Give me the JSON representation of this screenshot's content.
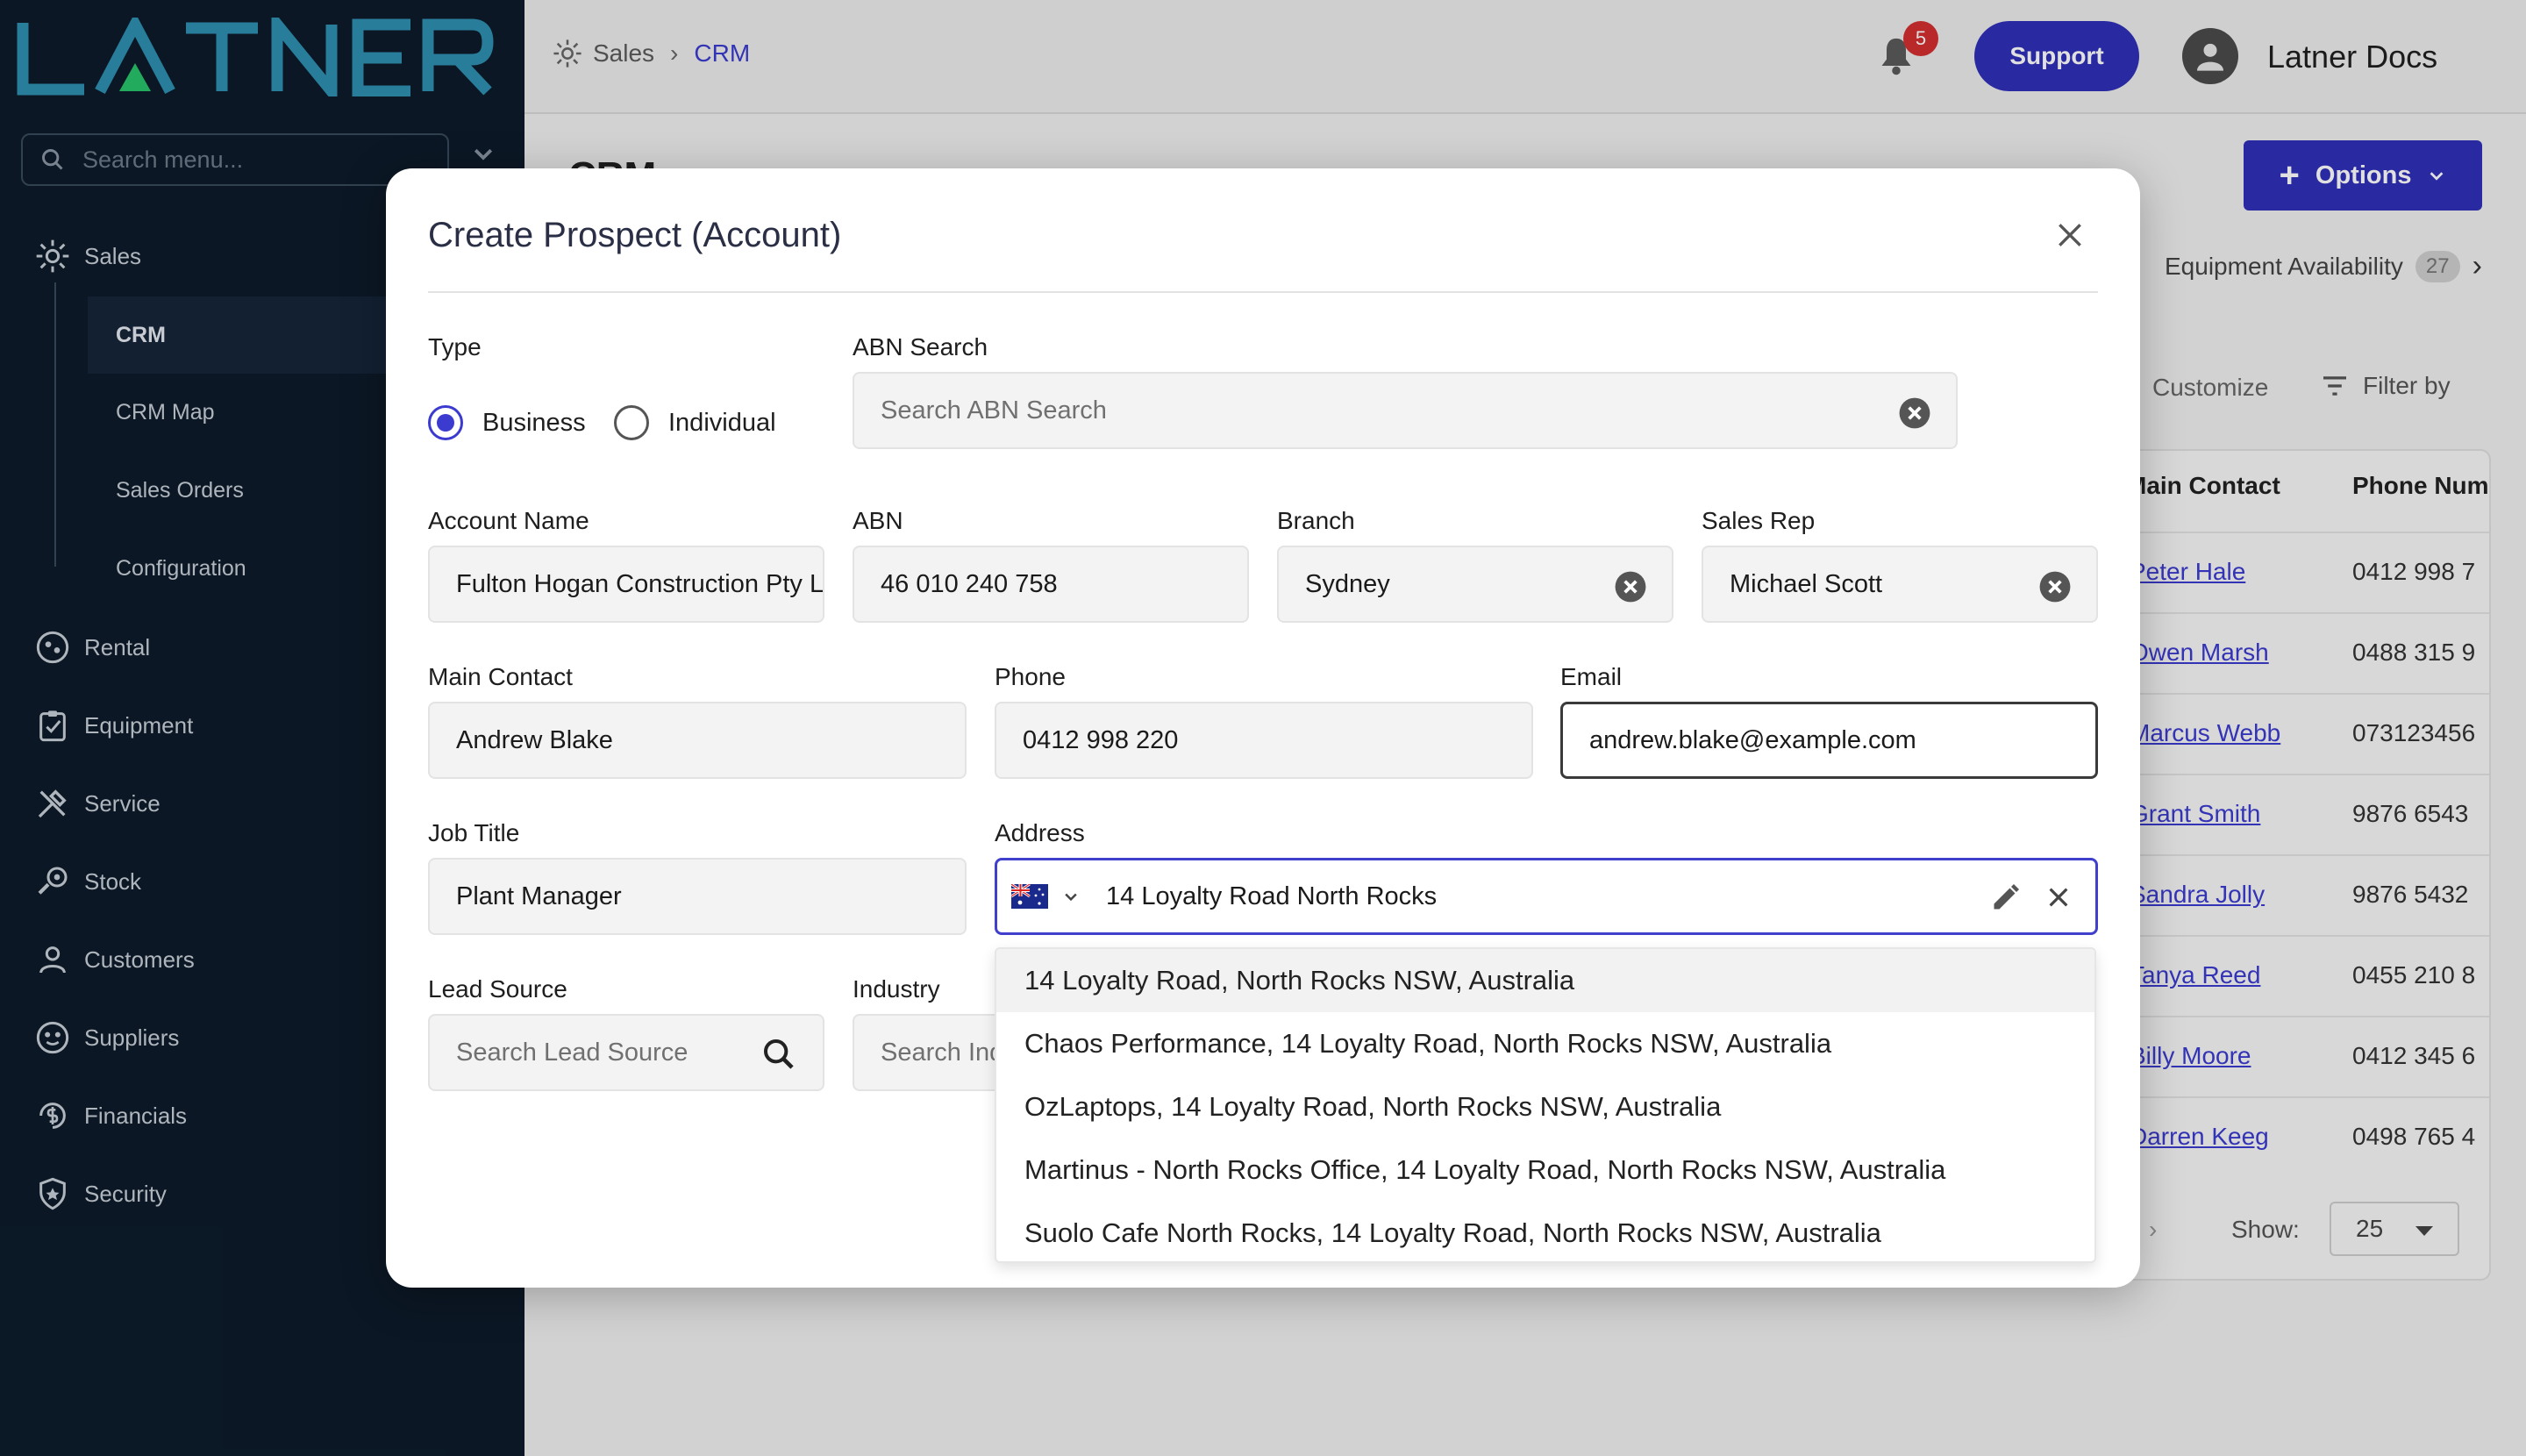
{
  "app": {
    "logo_text": "LATNER",
    "user_name": "Latner Docs",
    "support_label": "Support",
    "notification_count": "5"
  },
  "sidebar": {
    "search_placeholder": "Search menu...",
    "items": [
      {
        "label": "Sales",
        "icon": "sales-icon"
      },
      {
        "label": "Rental",
        "icon": "rental-icon"
      },
      {
        "label": "Equipment",
        "icon": "equipment-icon"
      },
      {
        "label": "Service",
        "icon": "service-icon"
      },
      {
        "label": "Stock",
        "icon": "stock-icon"
      },
      {
        "label": "Customers",
        "icon": "customers-icon"
      },
      {
        "label": "Suppliers",
        "icon": "suppliers-icon"
      },
      {
        "label": "Financials",
        "icon": "financials-icon"
      },
      {
        "label": "Security",
        "icon": "shield-icon"
      }
    ],
    "sales_sub": [
      {
        "label": "CRM",
        "active": true
      },
      {
        "label": "CRM Map"
      },
      {
        "label": "Sales Orders"
      },
      {
        "label": "Configuration"
      }
    ]
  },
  "breadcrumb": {
    "section": "Sales",
    "current": "CRM"
  },
  "page": {
    "title": "CRM",
    "options_label": "Options",
    "tab_equipment": "Equipment Availability",
    "tab_equipment_count": "27",
    "customize_label": "Customize",
    "filter_label": "Filter by",
    "show_label": "Show:",
    "show_value": "25"
  },
  "table": {
    "headers": [
      "Main Contact",
      "Phone Num"
    ],
    "rows": [
      [
        "Peter Hale",
        "0412 998 7"
      ],
      [
        "Owen Marsh",
        "0488 315 9"
      ],
      [
        "Marcus Webb",
        "073123456"
      ],
      [
        "Grant Smith",
        "9876 6543"
      ],
      [
        "Sandra Jolly",
        "9876 5432"
      ],
      [
        "Tanya Reed",
        "0455 210 8"
      ],
      [
        "Billy Moore",
        "0412 345 6"
      ],
      [
        "Darren Keeg",
        "0498 765 4"
      ]
    ]
  },
  "modal": {
    "title": "Create Prospect (Account)",
    "type_label": "Type",
    "type_options": [
      "Business",
      "Individual"
    ],
    "type_selected": "Business",
    "abn_search_label": "ABN Search",
    "abn_search_placeholder": "Search ABN Search",
    "account_name_label": "Account Name",
    "account_name_value": "Fulton Hogan Construction Pty Ltd",
    "abn_label": "ABN",
    "abn_value": "46 010 240 758",
    "branch_label": "Branch",
    "branch_value": "Sydney",
    "sales_rep_label": "Sales Rep",
    "sales_rep_value": "Michael Scott",
    "main_contact_label": "Main Contact",
    "main_contact_value": "Andrew Blake",
    "phone_label": "Phone",
    "phone_value": "0412 998 220",
    "email_label": "Email",
    "email_value": "andrew.blake@example.com",
    "job_title_label": "Job Title",
    "job_title_value": "Plant Manager",
    "address_label": "Address",
    "address_value": "14 Loyalty Road North Rocks",
    "lead_source_label": "Lead Source",
    "lead_source_placeholder": "Search Lead Source",
    "industry_label": "Industry",
    "industry_placeholder": "Search Industry",
    "address_suggestions": [
      "14 Loyalty Road, North Rocks NSW, Australia",
      "Chaos Performance, 14 Loyalty Road, North Rocks NSW, Australia",
      "OzLaptops, 14 Loyalty Road, North Rocks NSW, Australia",
      "Martinus - North Rocks Office, 14 Loyalty Road, North Rocks NSW, Australia",
      "Suolo Cafe North Rocks, 14 Loyalty Road, North Rocks NSW, Australia"
    ]
  },
  "colors": {
    "accent": "#2f2fb8",
    "sidebar_bg": "#0d1b2a",
    "logo": "#4a9fbf",
    "badge": "#d32f2f"
  }
}
